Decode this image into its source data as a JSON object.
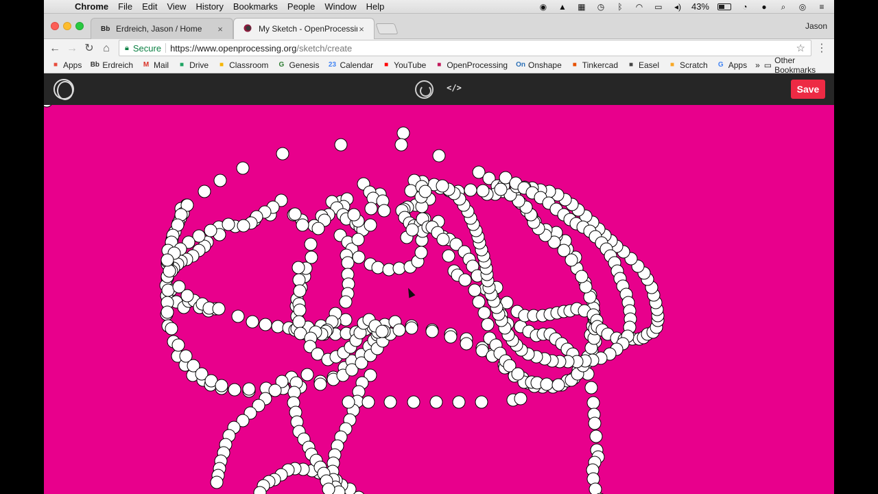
{
  "menubar": {
    "app": "Chrome",
    "items": [
      "File",
      "Edit",
      "View",
      "History",
      "Bookmarks",
      "People",
      "Window",
      "Help"
    ],
    "battery": "43%"
  },
  "tabs": [
    {
      "favicon": "Bb",
      "title": "Erdreich, Jason / Home"
    },
    {
      "favicon": "openprocessing-icon",
      "title": "My Sketch - OpenProcessing"
    }
  ],
  "profile": "Jason",
  "address": {
    "secure_label": "Secure",
    "url_base": "https://www.openprocessing.org",
    "url_path": "/sketch/create"
  },
  "bookmarks": [
    {
      "label": "Apps",
      "icon": "apps-grid-icon",
      "color": "#e74c3c"
    },
    {
      "label": "Erdreich",
      "icon": "Bb",
      "color": "#333333"
    },
    {
      "label": "Mail",
      "icon": "M",
      "color": "#d93025"
    },
    {
      "label": "Drive",
      "icon": "drive-icon",
      "color": "#1fa463"
    },
    {
      "label": "Classroom",
      "icon": "classroom-icon",
      "color": "#f6b400"
    },
    {
      "label": "Genesis",
      "icon": "G",
      "color": "#2e7d32"
    },
    {
      "label": "Calendar",
      "icon": "23",
      "color": "#4285f4"
    },
    {
      "label": "YouTube",
      "icon": "youtube-icon",
      "color": "#ff0000"
    },
    {
      "label": "OpenProcessing",
      "icon": "openprocessing-icon",
      "color": "#c2185b"
    },
    {
      "label": "Onshape",
      "icon": "On",
      "color": "#2a6fb6"
    },
    {
      "label": "Tinkercad",
      "icon": "tinkercad-icon",
      "color": "#e65100"
    },
    {
      "label": "Easel",
      "icon": "easel-icon",
      "color": "#444444"
    },
    {
      "label": "Scratch",
      "icon": "scratch-icon",
      "color": "#f9a825"
    },
    {
      "label": "Apps",
      "icon": "G",
      "color": "#4285f4"
    }
  ],
  "bookmarks_more": "»",
  "other_bookmarks": "Other Bookmarks",
  "editor": {
    "code_label": "</>",
    "save_label": "Save"
  },
  "sketch": {
    "background": "#e8008c",
    "dot_fill": "#ffffff",
    "dot_stroke": "#000000"
  }
}
